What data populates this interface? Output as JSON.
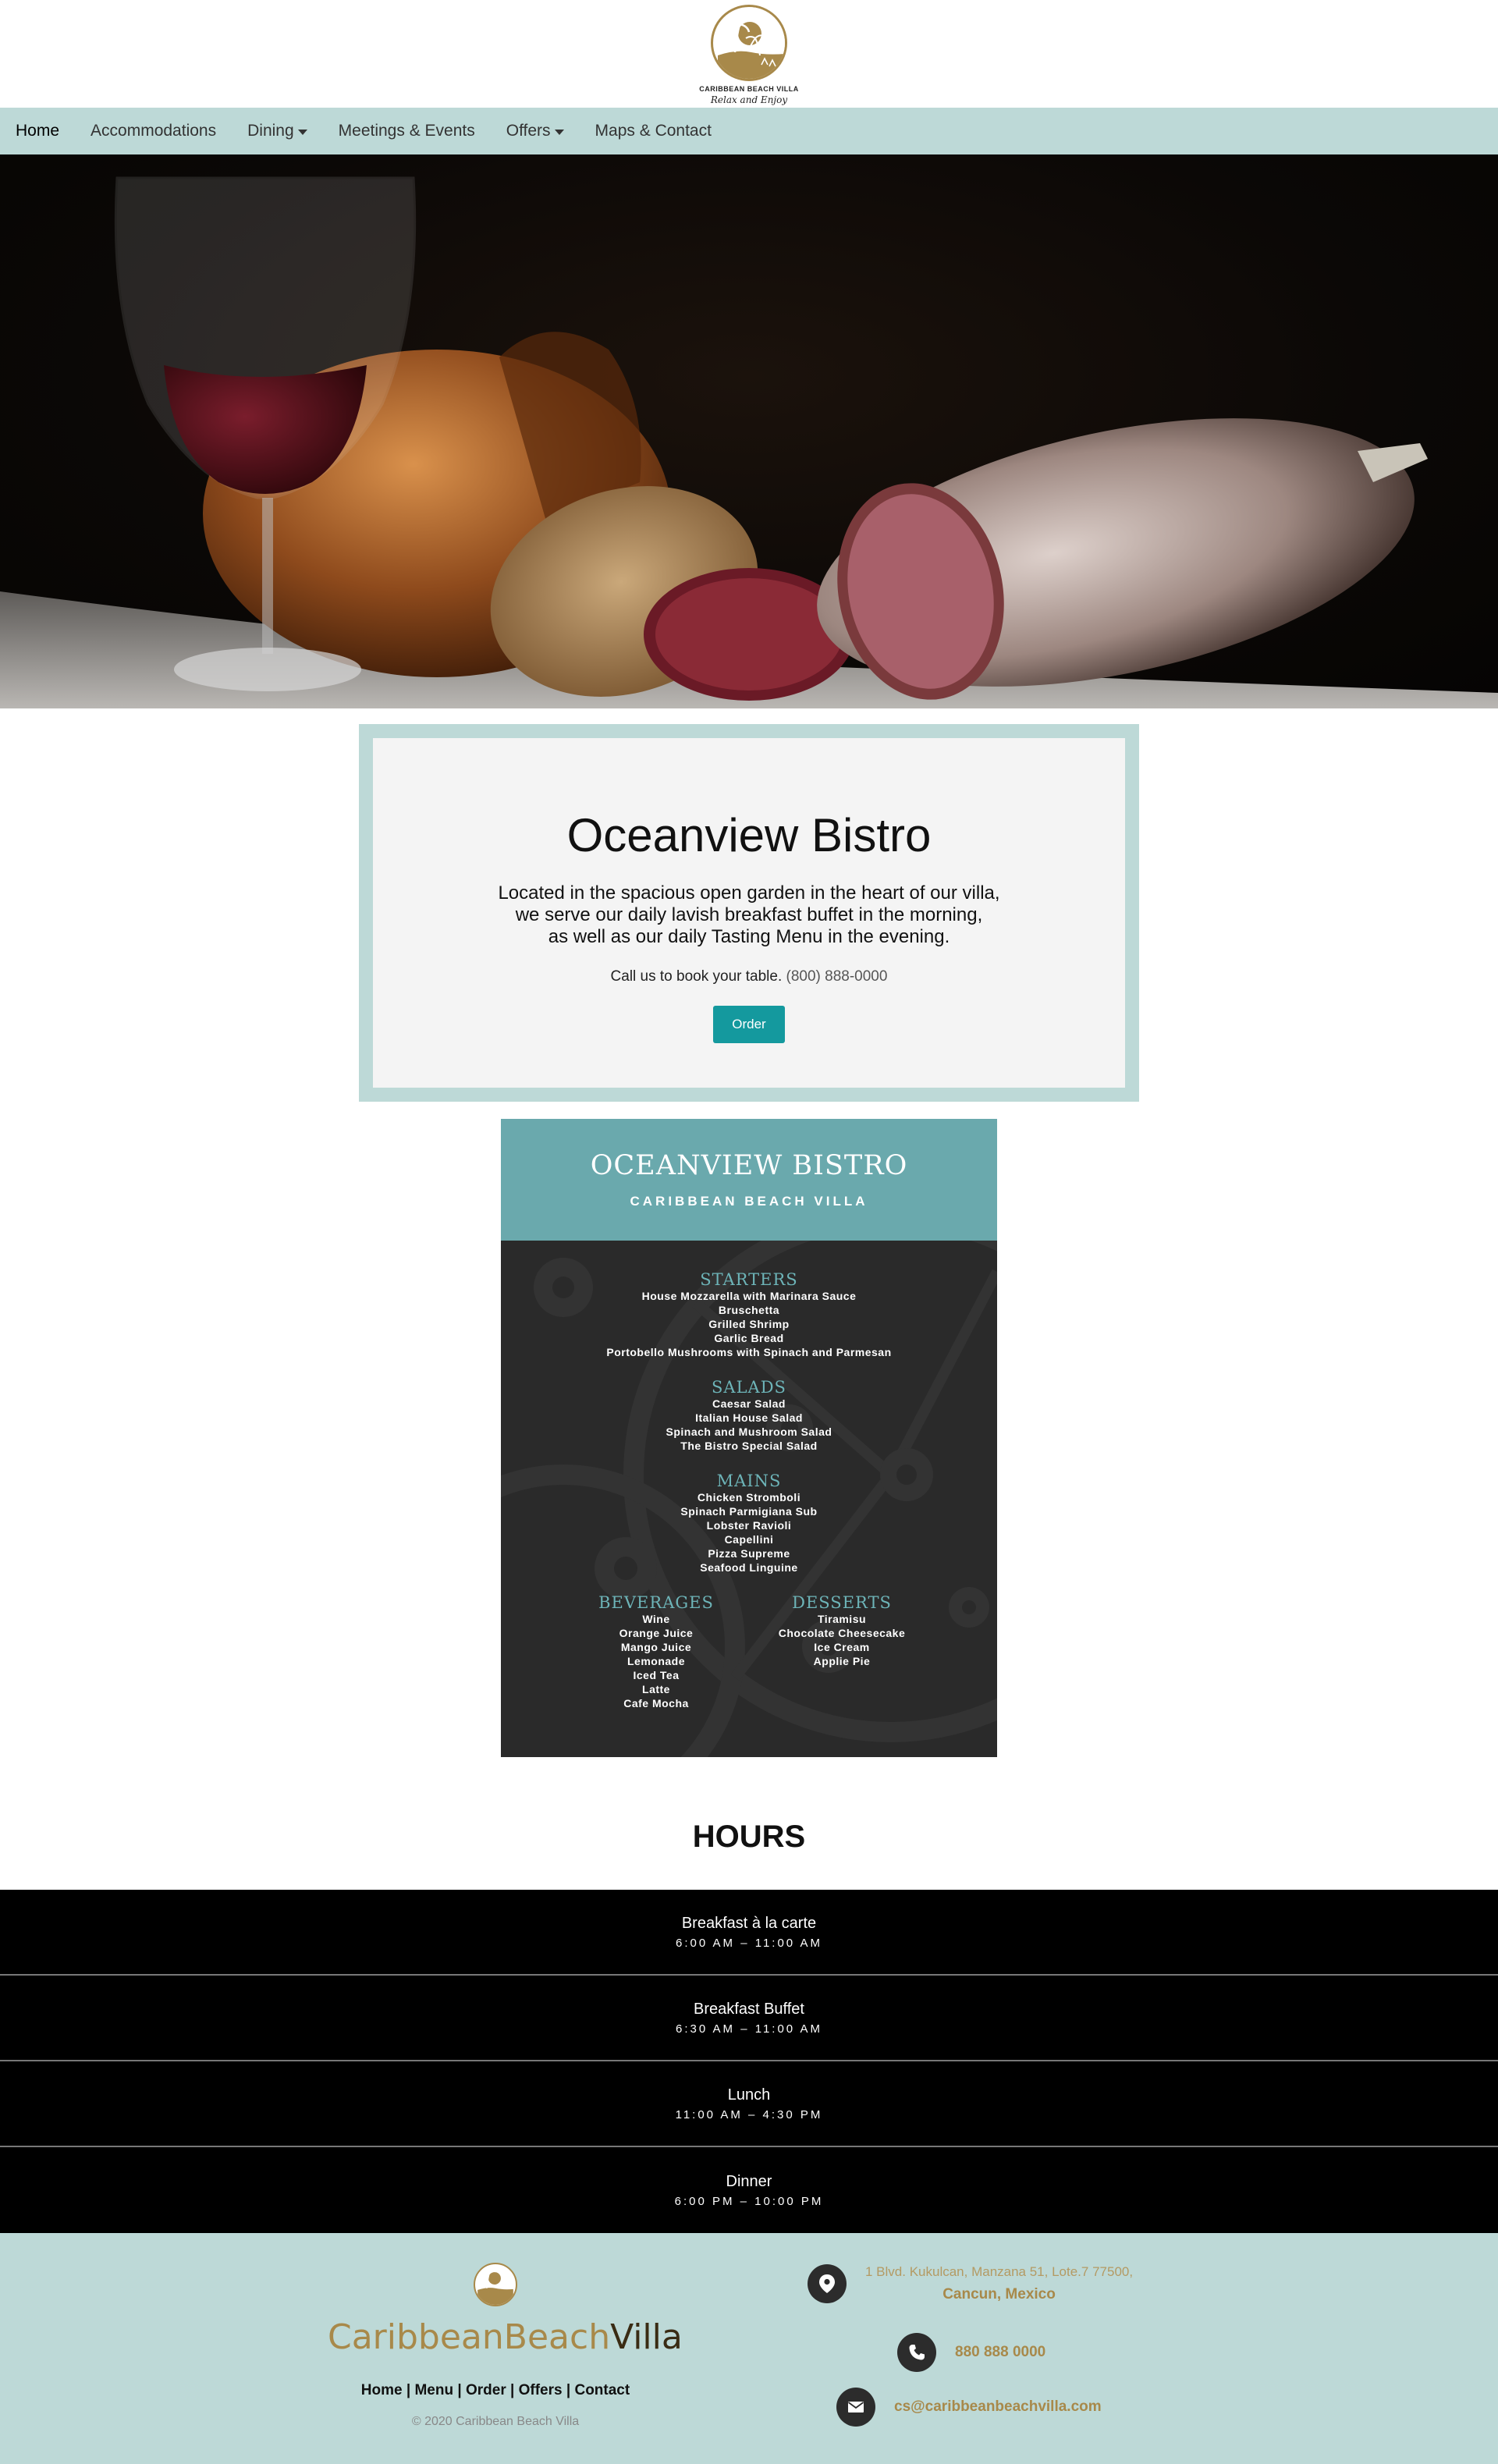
{
  "logo": {
    "brand": "CARIBBEAN BEACH VILLA",
    "tagline": "Relax and Enjoy",
    "icon": "palm-tree-logo-icon"
  },
  "nav": {
    "items": [
      {
        "label": "Home",
        "dropdown": false
      },
      {
        "label": "Accommodations",
        "dropdown": false
      },
      {
        "label": "Dining",
        "dropdown": true
      },
      {
        "label": "Meetings & Events",
        "dropdown": false
      },
      {
        "label": "Offers",
        "dropdown": true
      },
      {
        "label": "Maps & Contact",
        "dropdown": false
      }
    ]
  },
  "intro": {
    "title": "Oceanview Bistro",
    "desc_line1": "Located in the spacious open garden in the heart of our villa,",
    "desc_line2": "we serve our daily lavish breakfast buffet in the morning,",
    "desc_line3": "as well as our daily Tasting Menu in the evening.",
    "call_text": "Call us to book your table.",
    "phone": "(800) 888-0000",
    "order_label": "Order"
  },
  "menu": {
    "title": "OCEANVIEW BISTRO",
    "subtitle": "CARIBBEAN BEACH VILLA",
    "starters": {
      "title": "STARTERS",
      "items": [
        "House Mozzarella with Marinara Sauce",
        "Bruschetta",
        "Grilled Shrimp",
        "Garlic Bread",
        "Portobello Mushrooms with Spinach and Parmesan"
      ]
    },
    "salads": {
      "title": "SALADS",
      "items": [
        "Caesar Salad",
        "Italian House Salad",
        "Spinach and Mushroom Salad",
        "The Bistro Special Salad"
      ]
    },
    "mains": {
      "title": "MAINS",
      "items": [
        "Chicken Stromboli",
        "Spinach Parmigiana Sub",
        "Lobster Ravioli",
        "Capellini",
        "Pizza Supreme",
        "Seafood Linguine"
      ]
    },
    "beverages": {
      "title": "BEVERAGES",
      "items": [
        "Wine",
        "Orange Juice",
        "Mango Juice",
        "Lemonade",
        "Iced Tea",
        "Latte",
        "Cafe Mocha"
      ]
    },
    "desserts": {
      "title": "DESSERTS",
      "items": [
        "Tiramisu",
        "Chocolate Cheesecake",
        "Ice Cream",
        "Applie Pie"
      ]
    }
  },
  "hours": {
    "title": "HOURS",
    "rows": [
      {
        "meal": "Breakfast à la carte",
        "time": "6:00 AM – 11:00 AM"
      },
      {
        "meal": "Breakfast Buffet",
        "time": "6:30 AM – 11:00 AM"
      },
      {
        "meal": "Lunch",
        "time": "11:00 AM – 4:30 PM"
      },
      {
        "meal": "Dinner",
        "time": "6:00 PM – 10:00 PM"
      }
    ]
  },
  "footer": {
    "brand_part1": "CaribbeanBeach",
    "brand_part2": "Villa",
    "links": [
      "Home",
      "Menu",
      "Order",
      "Offers",
      "Contact"
    ],
    "copyright": "© 2020 Caribbean Beach Villa",
    "address_line1": "1 Blvd. Kukulcan, Manzana 51, Lote.7 77500,",
    "address_line2": "Cancun, Mexico",
    "phone": "880 888 0000",
    "email": "cs@caribbeanbeachvilla.com"
  },
  "colors": {
    "nav_bg": "#bdd9d7",
    "accent": "#14999e",
    "gold": "#a8894a",
    "menu_teal": "#6aa9ad"
  }
}
